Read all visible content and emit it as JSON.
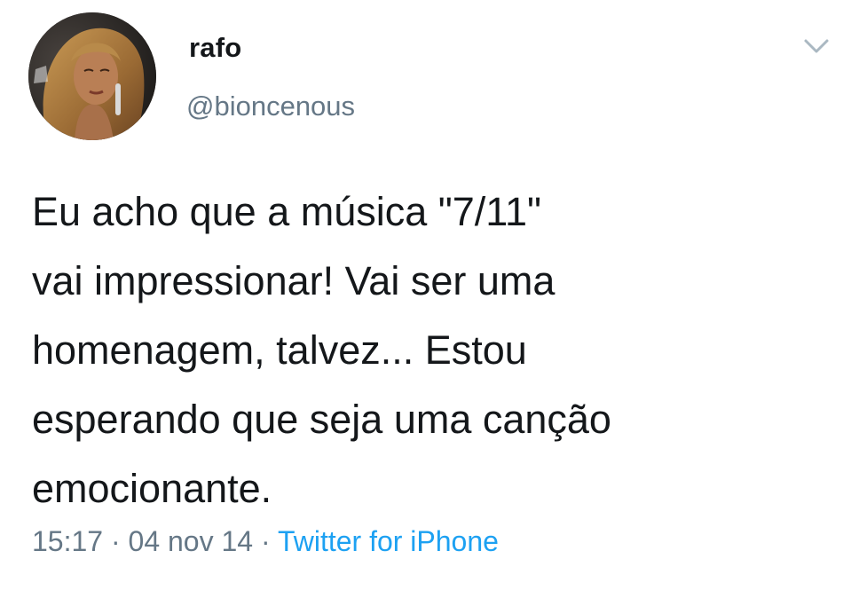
{
  "user": {
    "display_name": "rafo",
    "handle": "@bioncenous",
    "avatar": "profile-photo"
  },
  "menu": {
    "icon": "chevron-down-icon"
  },
  "tweet": {
    "lines": [
      "Eu acho que a música \"7/11\"",
      "vai impressionar! Vai ser uma",
      "homenagem, talvez... Estou",
      "esperando que seja uma canção",
      "emocionante."
    ]
  },
  "meta": {
    "time": "15:17",
    "separator": " · ",
    "date": "04 nov 14",
    "source": "Twitter for iPhone"
  },
  "colors": {
    "text": "#14171a",
    "secondary": "#657786",
    "link": "#1da1f2"
  }
}
